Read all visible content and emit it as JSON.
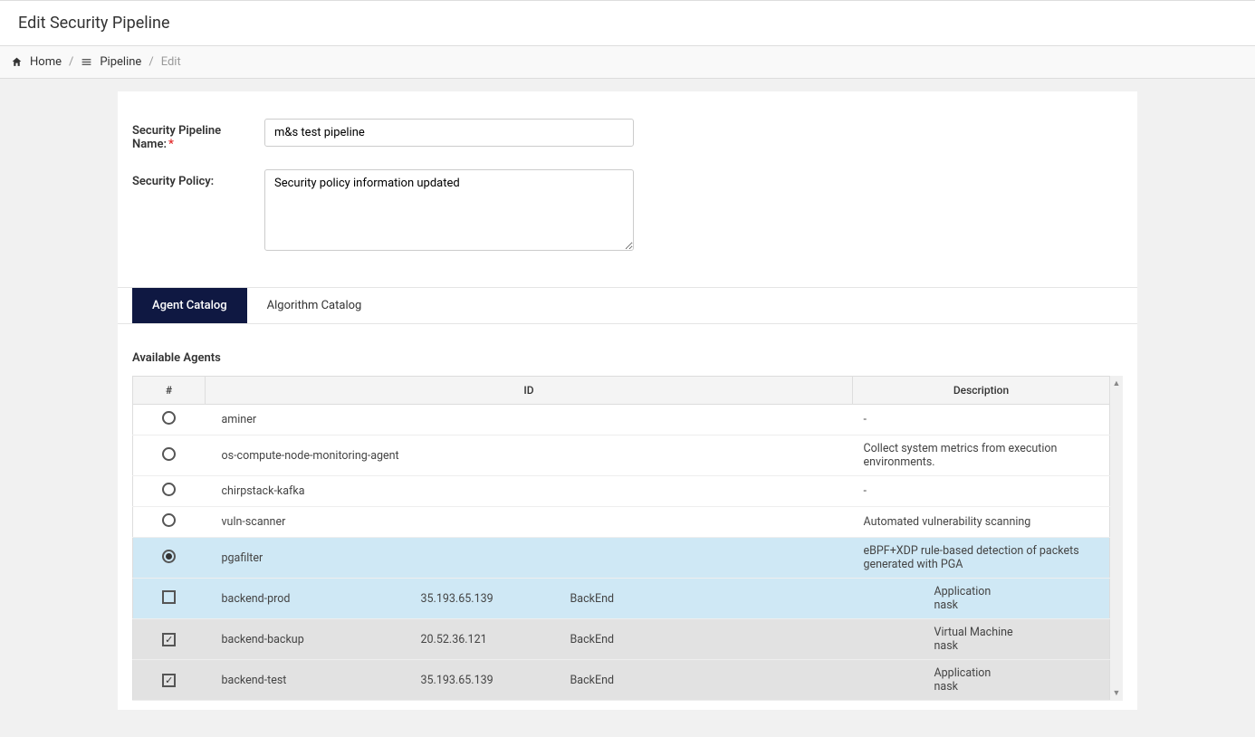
{
  "header": {
    "title": "Edit Security Pipeline"
  },
  "breadcrumb": {
    "home": "Home",
    "pipeline": "Pipeline",
    "current": "Edit"
  },
  "form": {
    "name_label": "Security Pipeline Name:",
    "name_value": "m&s test pipeline",
    "policy_label": "Security Policy:",
    "policy_value": "Security policy information updated"
  },
  "tabs": {
    "agent": "Agent Catalog",
    "algorithm": "Algorithm Catalog"
  },
  "agents": {
    "section_title": "Available Agents",
    "columns": {
      "select": "#",
      "id": "ID",
      "desc": "Description"
    },
    "rows": [
      {
        "selected": false,
        "id": "aminer",
        "desc": "-"
      },
      {
        "selected": false,
        "id": "os-compute-node-monitoring-agent",
        "desc": "Collect system metrics from execution environments."
      },
      {
        "selected": false,
        "id": "chirpstack-kafka",
        "desc": "-"
      },
      {
        "selected": false,
        "id": "vuln-scanner",
        "desc": "Automated vulnerability scanning"
      },
      {
        "selected": true,
        "id": "pgafilter",
        "desc": "eBPF+XDP rule-based detection of packets generated with PGA"
      }
    ],
    "subrows": [
      {
        "checked": false,
        "id": "backend-prod",
        "ip": "35.193.65.139",
        "role": "BackEnd",
        "type": "Application",
        "owner": "nask"
      },
      {
        "checked": true,
        "id": "backend-backup",
        "ip": "20.52.36.121",
        "role": "BackEnd",
        "type": "Virtual Machine",
        "owner": "nask"
      },
      {
        "checked": true,
        "id": "backend-test",
        "ip": "35.193.65.139",
        "role": "BackEnd",
        "type": "Application",
        "owner": "nask"
      }
    ]
  }
}
